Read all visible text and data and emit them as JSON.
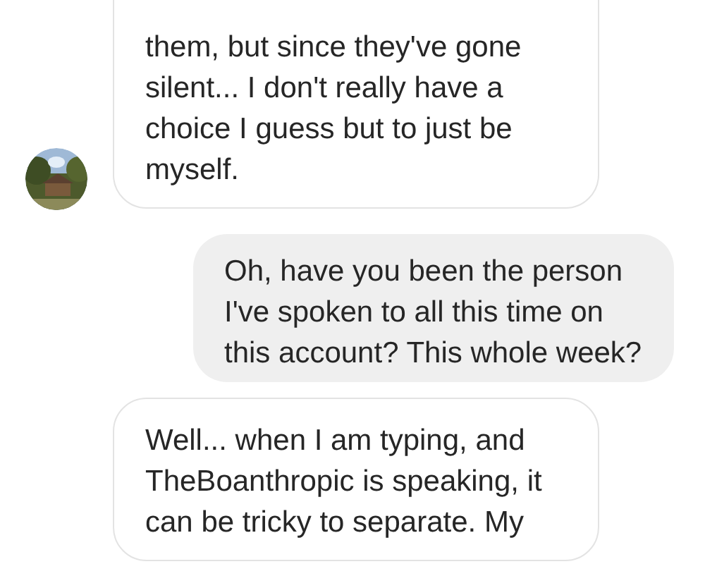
{
  "messages": [
    {
      "outgoing": false,
      "avatar": true,
      "text": "them, but since they've gone silent... I don't really have a choice I guess but to just be myself."
    },
    {
      "outgoing": true,
      "avatar": false,
      "text": "Oh, have you been the person I've spoken to all this time on this account? This whole week?"
    },
    {
      "outgoing": false,
      "avatar": false,
      "text": "Well... when I am typing, and TheBoanthropic is speaking, it can be tricky to separate. My"
    }
  ]
}
